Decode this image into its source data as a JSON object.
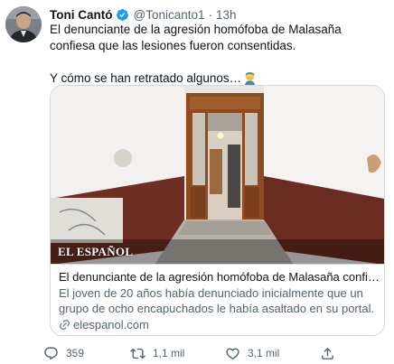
{
  "tweet": {
    "author_name": "Toni Cantó",
    "handle": "@Tonicanto1",
    "separator": "·",
    "time": "13h",
    "text_line_1": "El denunciante de la agresión homófoba de Malasaña confiesa que las lesiones fueron consentidas.",
    "text_line_2": "Y cómo se han retratado algunos…"
  },
  "card": {
    "logo": "EL ESPAÑOL",
    "title": "El denunciante de la agresión homófoba de Malasaña confiesa que la…",
    "description": "El joven de 20 años había denunciado inicialmente que un grupo de ocho encapuchados le había asaltado en su portal.",
    "domain": "elespanol.com"
  },
  "actions": {
    "reply_count": "359",
    "retweet_count": "1,1 mil",
    "like_count": "3,1 mil"
  },
  "colors": {
    "text": "#0f1419",
    "secondary": "#536471",
    "border": "#cfd9de",
    "verified": "#1d9bf0"
  },
  "icons": [
    "avatar",
    "verified-badge-icon",
    "facepalm-emoji",
    "link-icon",
    "reply-icon",
    "retweet-icon",
    "like-icon",
    "share-icon"
  ]
}
